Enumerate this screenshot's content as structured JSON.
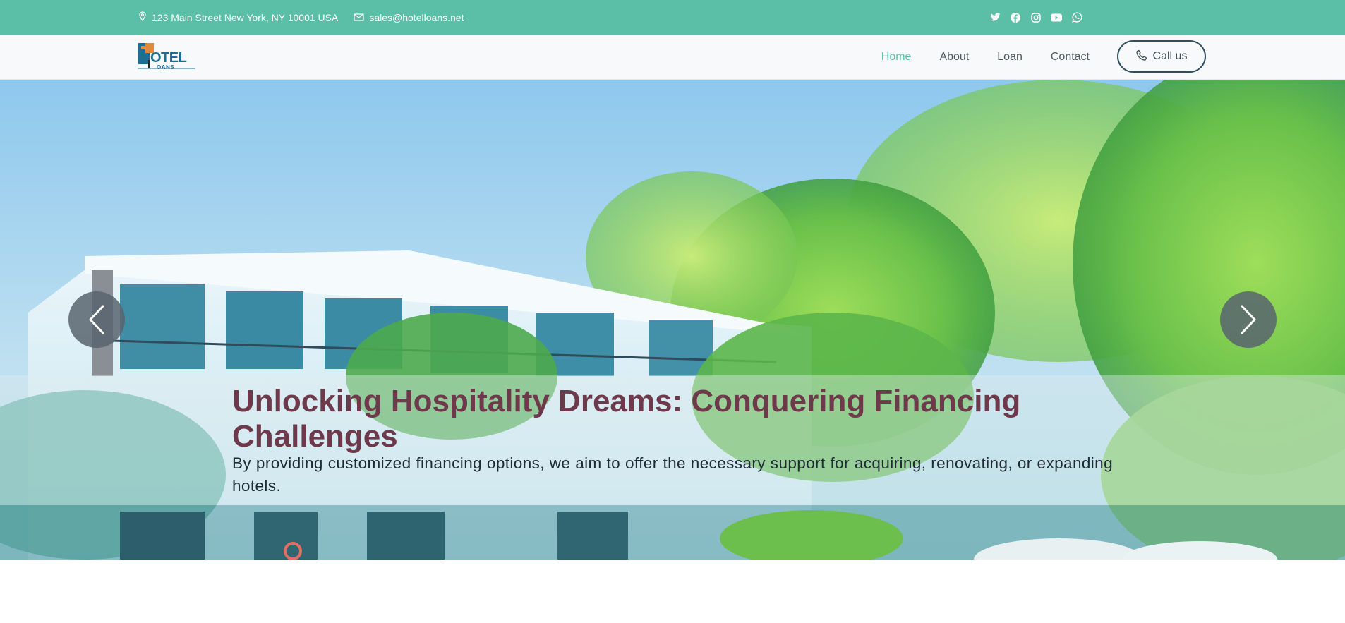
{
  "topbar": {
    "address": "123 Main Street New York, NY 10001 USA",
    "email": "sales@hotelloans.net",
    "social": [
      "twitter-icon",
      "facebook-icon",
      "instagram-icon",
      "youtube-icon",
      "whatsapp-icon"
    ]
  },
  "logo": {
    "word": "OTEL",
    "word2": "OANS"
  },
  "nav": {
    "items": [
      {
        "label": "Home",
        "active": true
      },
      {
        "label": "About",
        "active": false
      },
      {
        "label": "Loan",
        "active": false
      },
      {
        "label": "Contact",
        "active": false
      }
    ],
    "call_label": "Call us"
  },
  "hero": {
    "title": "Unlocking Hospitality Dreams: Conquering Financing Challenges",
    "text": "By providing customized financing options, we aim to offer the necessary support for acquiring, renovating, or expanding hotels."
  },
  "colors": {
    "accent": "#5bbfa8",
    "title": "#6e3a4b",
    "nav_text": "#4d5b61"
  }
}
